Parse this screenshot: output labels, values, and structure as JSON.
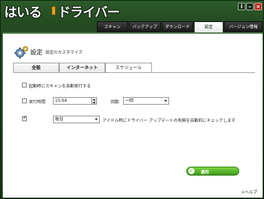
{
  "app": {
    "logo_hiragana": "はいる",
    "logo_katakana": "ドライバー"
  },
  "window_controls": {
    "info": "i",
    "minimize": "–",
    "close": "×"
  },
  "nav": {
    "tabs": [
      {
        "label": "スキャン"
      },
      {
        "label": "バックアップ"
      },
      {
        "label": "ダウンロード"
      },
      {
        "label": "設定",
        "active": true
      },
      {
        "label": "バージョン情報"
      }
    ]
  },
  "settings": {
    "title": "設定",
    "subtitle": "設定のカスタマイズ",
    "subtabs": [
      {
        "label": "全般"
      },
      {
        "label": "インターネット"
      },
      {
        "label": "スケジュール",
        "active": true
      }
    ],
    "options": {
      "autoscan_label": "起動時にスキャンを自動実行する",
      "autoscan_checked": false,
      "runtime_checked": false,
      "runtime_label": "実行時間",
      "runtime_value": "15:04",
      "count_label": "回数",
      "count_value": "一回",
      "idle_checked": true,
      "idle_frequency": "毎日",
      "idle_label": "アイドル時にドライバー アップデートの有無を自動的にチェックします"
    },
    "apply_label": "適用",
    "help_label": ">ヘルプ"
  },
  "colors": {
    "frame": "#244b22",
    "accent": "#4f7e4a",
    "apply_button": "#5bb52c",
    "close_button": "#b8231d"
  }
}
